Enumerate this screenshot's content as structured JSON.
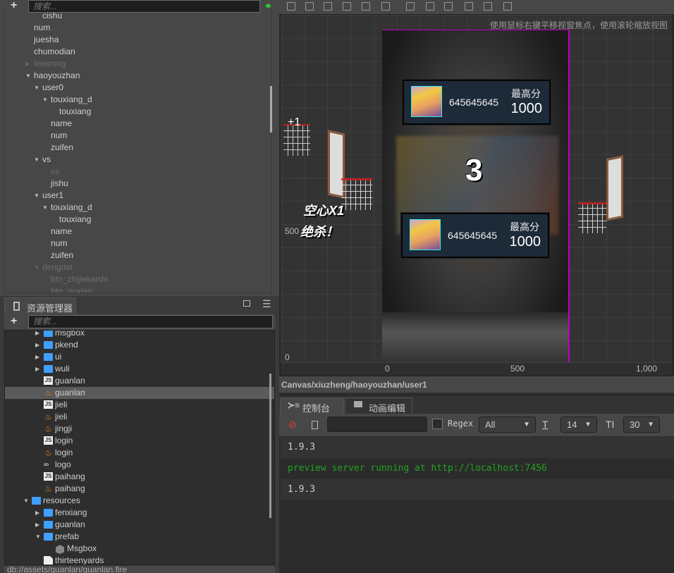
{
  "hierarchy": {
    "search_placeholder": "搜索...",
    "items": [
      {
        "label": "cishu",
        "level": 1,
        "dim": false,
        "arrow": ""
      },
      {
        "label": "num",
        "level": 0,
        "dim": false,
        "arrow": ""
      },
      {
        "label": "juesha",
        "level": 0,
        "dim": false,
        "arrow": ""
      },
      {
        "label": "chumodian",
        "level": 0,
        "dim": false,
        "arrow": ""
      },
      {
        "label": "lineirong",
        "level": 0,
        "dim": true,
        "arrow": "collapsed"
      },
      {
        "label": "haoyouzhan",
        "level": 0,
        "dim": false,
        "arrow": "expanded"
      },
      {
        "label": "user0",
        "level": 1,
        "dim": false,
        "arrow": "expanded"
      },
      {
        "label": "touxiang_d",
        "level": 2,
        "dim": false,
        "arrow": "expanded"
      },
      {
        "label": "touxiang",
        "level": 3,
        "dim": false,
        "arrow": ""
      },
      {
        "label": "name",
        "level": 2,
        "dim": false,
        "arrow": ""
      },
      {
        "label": "num",
        "level": 2,
        "dim": false,
        "arrow": ""
      },
      {
        "label": "zuifen",
        "level": 2,
        "dim": false,
        "arrow": ""
      },
      {
        "label": "vs",
        "level": 1,
        "dim": false,
        "arrow": "expanded"
      },
      {
        "label": "vs",
        "level": 2,
        "dim": true,
        "arrow": ""
      },
      {
        "label": "jishu",
        "level": 2,
        "dim": false,
        "arrow": ""
      },
      {
        "label": "user1",
        "level": 1,
        "dim": false,
        "arrow": "expanded"
      },
      {
        "label": "touxiang_d",
        "level": 2,
        "dim": false,
        "arrow": "expanded"
      },
      {
        "label": "touxiang",
        "level": 3,
        "dim": false,
        "arrow": ""
      },
      {
        "label": "name",
        "level": 2,
        "dim": false,
        "arrow": ""
      },
      {
        "label": "num",
        "level": 2,
        "dim": false,
        "arrow": ""
      },
      {
        "label": "zuifen",
        "level": 2,
        "dim": false,
        "arrow": ""
      },
      {
        "label": "dengdai",
        "level": 1,
        "dim": true,
        "arrow": "expanded"
      },
      {
        "label": "btn_zhijiekaishi",
        "level": 2,
        "dim": true,
        "arrow": ""
      },
      {
        "label": "btn_quxiao",
        "level": 2,
        "dim": true,
        "arrow": ""
      }
    ]
  },
  "assets": {
    "title": "资源管理器",
    "search_placeholder": "搜索...",
    "items": [
      {
        "label": "msgbox",
        "level": 1,
        "type": "folder",
        "arrow": "collapsed"
      },
      {
        "label": "pkend",
        "level": 1,
        "type": "folder",
        "arrow": "collapsed"
      },
      {
        "label": "ui",
        "level": 1,
        "type": "folder",
        "arrow": "collapsed"
      },
      {
        "label": "wuli",
        "level": 1,
        "type": "folder",
        "arrow": "collapsed"
      },
      {
        "label": "guanlan",
        "level": 1,
        "type": "js",
        "arrow": ""
      },
      {
        "label": "guanlan",
        "level": 1,
        "type": "fire",
        "arrow": "",
        "selected": true
      },
      {
        "label": "jieli",
        "level": 1,
        "type": "js",
        "arrow": ""
      },
      {
        "label": "jieli",
        "level": 1,
        "type": "fire",
        "arrow": ""
      },
      {
        "label": "jingji",
        "level": 1,
        "type": "fire",
        "arrow": ""
      },
      {
        "label": "login",
        "level": 1,
        "type": "js",
        "arrow": ""
      },
      {
        "label": "login",
        "level": 1,
        "type": "fire",
        "arrow": ""
      },
      {
        "label": "logo",
        "level": 1,
        "type": "sprite",
        "arrow": ""
      },
      {
        "label": "paihang",
        "level": 1,
        "type": "js",
        "arrow": ""
      },
      {
        "label": "paihang",
        "level": 1,
        "type": "fire",
        "arrow": ""
      },
      {
        "label": "resources",
        "level": 0,
        "type": "folder",
        "arrow": "expanded"
      },
      {
        "label": "fenxiang",
        "level": 1,
        "type": "folder",
        "arrow": "collapsed"
      },
      {
        "label": "guanlan",
        "level": 1,
        "type": "folder",
        "arrow": "collapsed"
      },
      {
        "label": "prefab",
        "level": 1,
        "type": "folder",
        "arrow": "expanded"
      },
      {
        "label": "Msgbox",
        "level": 2,
        "type": "prefab",
        "arrow": ""
      },
      {
        "label": "thirteenyards",
        "level": 1,
        "type": "file",
        "arrow": ""
      }
    ],
    "status_path": "db://assets/guanlan/guanlan.fire"
  },
  "scene": {
    "hint": "使用鼠标右键平移视窗焦点，使用滚轮缩放视图",
    "ruler_x": [
      "0",
      "500",
      "1,000"
    ],
    "ruler_y": [
      "500",
      "0"
    ],
    "node_path": "Canvas/xiuzheng/haoyouzhan/user1",
    "game": {
      "player1": {
        "id": "645645645",
        "label": "最高分",
        "score": "1000"
      },
      "player2": {
        "id": "645645645",
        "label": "最高分",
        "score": "1000"
      },
      "countdown": "3",
      "plus_one": "+1",
      "combo_text": "空心X1",
      "kill_text": "绝杀！"
    },
    "accent_color": "#c000c0"
  },
  "console": {
    "tabs": [
      {
        "label": "控制台"
      },
      {
        "label": "动画编辑器"
      }
    ],
    "regex_label": "Regex",
    "level_select": "All",
    "font_size": "14",
    "line_height": "30",
    "logs": [
      {
        "text": "1.9.3",
        "color": "#cfcfcf"
      },
      {
        "text": "preview server running at http://localhost:7456",
        "color": "#1fa31f"
      },
      {
        "text": "1.9.3",
        "color": "#cfcfcf"
      }
    ]
  }
}
